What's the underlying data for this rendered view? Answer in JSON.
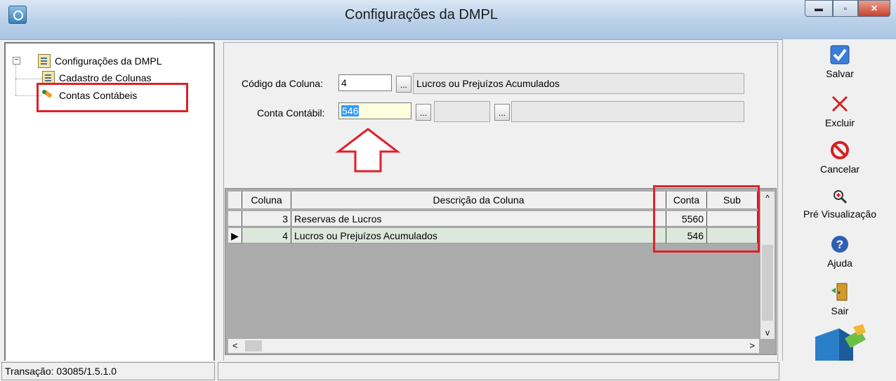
{
  "window": {
    "title": "Configurações da DMPL",
    "min": "▬",
    "max": "▫",
    "close": "✕"
  },
  "tree": {
    "root": "Configurações da DMPL",
    "expander": "−",
    "items": [
      {
        "label": "Cadastro de Colunas"
      },
      {
        "label": "Contas Contábeis"
      }
    ]
  },
  "form": {
    "codigo_label": "Código da Coluna:",
    "codigo_value": "4",
    "codigo_desc": "Lucros ou Prejuízos Acumulados",
    "conta_label": "Conta Contábil:",
    "conta_value": "546",
    "lookup_btn": "..."
  },
  "grid": {
    "columns": [
      "Coluna",
      "Descrição da Coluna",
      "Conta",
      "Sub"
    ],
    "rows": [
      {
        "coluna": "3",
        "descricao": "Reservas de Lucros",
        "conta": "5560",
        "sub": ""
      },
      {
        "coluna": "4",
        "descricao": "Lucros ou Prejuízos Acumulados",
        "conta": "546",
        "sub": ""
      }
    ],
    "scroll_up": "^",
    "scroll_down": "v",
    "scroll_left": "<",
    "scroll_right": ">"
  },
  "toolbar": {
    "salvar": "Salvar",
    "excluir": "Excluir",
    "cancelar": "Cancelar",
    "previsualizacao": "Pré Visualização",
    "ajuda": "Ajuda",
    "sair": "Sair"
  },
  "status": {
    "transacao": "Transação: 03085/1.5.1.0",
    "message": ""
  },
  "colors": {
    "highlight_red": "#e0202a",
    "selected_row": "#dce8dc",
    "selection_blue": "#3399ff"
  }
}
